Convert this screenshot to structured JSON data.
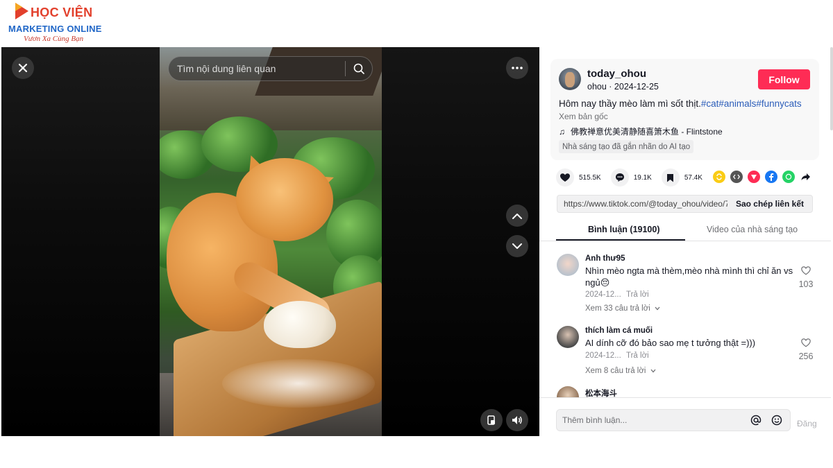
{
  "logo": {
    "line1": "HỌC VIỆN",
    "line2": "MARKETING ONLINE",
    "slogan": "Vươn Xa Cùng Bạn",
    "colors": {
      "red": "#e2402c",
      "blue": "#1f66c7"
    }
  },
  "player": {
    "search_placeholder": "Tìm nội dung liên quan",
    "icons": [
      "close-icon",
      "search-icon",
      "more-icon",
      "chevron-up-icon",
      "chevron-down-icon",
      "pip-icon",
      "volume-icon"
    ]
  },
  "video_info": {
    "username": "today_ohou",
    "handle_date": "ohou · 2024-12-25",
    "follow_label": "Follow",
    "caption_text": "Hôm nay thầy mèo làm mì sốt thịt.",
    "caption_tags": "#cat#animals#funnycats",
    "see_original": "Xem bản gốc",
    "music": "佛教禅意优美清静随喜箫木鱼 - Flintstone",
    "ai_label": "Nhà sáng tạo đã gắn nhãn do AI tạo",
    "accent_color": "#fe2c55"
  },
  "stats": {
    "likes": "515.5K",
    "comments": "19.1K",
    "saves": "57.4K"
  },
  "share": {
    "link": "https://www.tiktok.com/@today_ohou/video/7...",
    "copy_label": "Sao chép liên kết",
    "targets": [
      "repost-icon",
      "embed-icon",
      "send-icon",
      "facebook-icon",
      "whatsapp-icon",
      "share-icon"
    ]
  },
  "tabs": {
    "comments": "Bình luận (19100)",
    "creator_videos": "Video của nhà sáng tạo"
  },
  "comments": [
    {
      "name": "Anh thư95",
      "text": "Nhìn mèo ngta mà thèm,mèo nhà mình thì chỉ ăn vs ngủ😔",
      "date": "2024-12...",
      "reply": "Trả lời",
      "more": "Xem 33 câu trả lời",
      "likes": "103"
    },
    {
      "name": "thích làm cá muối",
      "text": "AI dính cỡ đó bảo sao mẹ t tưởng thật =)))",
      "date": "2024-12...",
      "reply": "Trả lời",
      "more": "Xem 8 câu trả lời",
      "likes": "256"
    },
    {
      "name": "松本海斗"
    }
  ],
  "composer": {
    "placeholder": "Thêm bình luận...",
    "post_label": "Đăng"
  }
}
